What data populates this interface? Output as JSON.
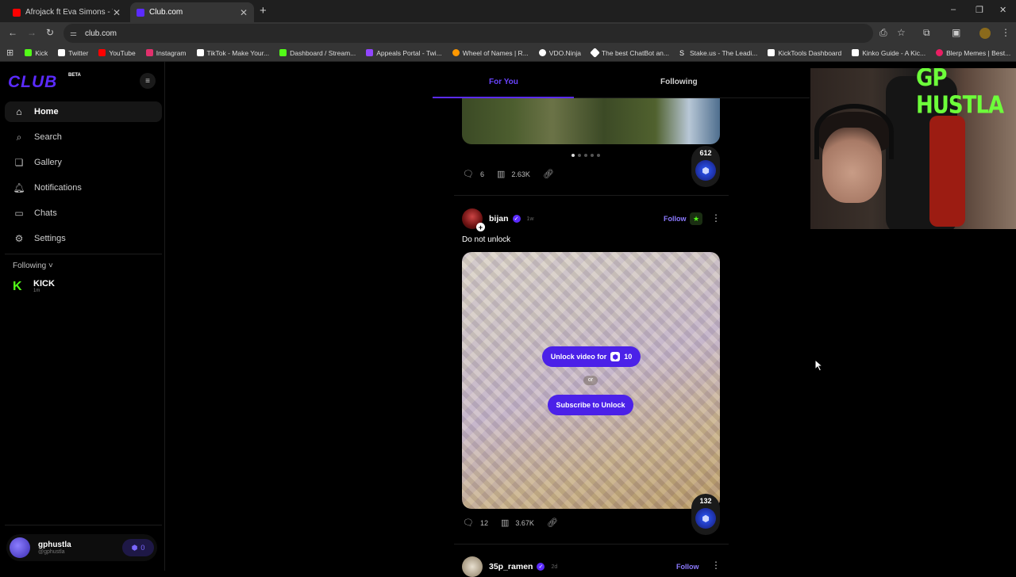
{
  "browser": {
    "tabs": [
      {
        "title": "Afrojack ft Eva Simons - Take O",
        "close": "✕"
      },
      {
        "title": "Club.com",
        "close": "✕"
      }
    ],
    "new_tab": "+",
    "window_controls": {
      "minimize": "–",
      "restore": "❐",
      "close": "✕"
    },
    "url": "club.com",
    "bookmarks": [
      {
        "label": "Kick",
        "color": "#53fc18"
      },
      {
        "label": "Twitter",
        "color": "#ffffff"
      },
      {
        "label": "YouTube",
        "color": "#ff0000"
      },
      {
        "label": "Instagram",
        "color": "#e1306c"
      },
      {
        "label": "TikTok - Make Your...",
        "color": "#ffffff"
      },
      {
        "label": "Dashboard / Stream...",
        "color": "#53fc18"
      },
      {
        "label": "Appeals Portal - Twi...",
        "color": "#9146ff"
      },
      {
        "label": "Wheel of Names | R...",
        "color": "#ff9800"
      },
      {
        "label": "VDO.Ninja",
        "color": "#ffffff"
      },
      {
        "label": "The best ChatBot an...",
        "color": "#ffffff"
      },
      {
        "label": "Stake.us - The Leadi...",
        "color": "#ffffff"
      },
      {
        "label": "KickTools Dashboard",
        "color": "#ffffff"
      },
      {
        "label": "Kinko Guide - A Kic...",
        "color": "#ffffff"
      },
      {
        "label": "Blerp Memes | Best...",
        "color": "#e91e63"
      }
    ]
  },
  "sidebar": {
    "logo": "CLUB",
    "beta": "BETA",
    "nav": [
      {
        "label": "Home",
        "icon": "⌂"
      },
      {
        "label": "Search",
        "icon": "⌕"
      },
      {
        "label": "Gallery",
        "icon": "❏"
      },
      {
        "label": "Notifications",
        "icon": "♫"
      },
      {
        "label": "Chats",
        "icon": "▭"
      },
      {
        "label": "Settings",
        "icon": "⚙"
      }
    ],
    "following_header": "Following ˅",
    "following": [
      {
        "name": "KICK",
        "sub": "1m"
      }
    ],
    "user": {
      "name": "gphustla",
      "handle": "@gphustla",
      "coins": "0"
    }
  },
  "feed": {
    "tabs": {
      "for_you": "For You",
      "following": "Following"
    },
    "post1": {
      "comments": "6",
      "views": "2.63K",
      "badge": "612"
    },
    "post2": {
      "author": "bijan",
      "time": "1w",
      "follow": "Follow",
      "text": "Do not unlock",
      "unlock_label": "Unlock video for",
      "unlock_price": "10",
      "or": "or",
      "subscribe": "Subscribe to Unlock",
      "comments": "12",
      "views": "3.67K",
      "badge": "132"
    },
    "post3": {
      "author": "35p_ramen",
      "time": "2d",
      "follow": "Follow"
    }
  },
  "overlay": {
    "webcam_text": "GP HUSTLA"
  }
}
